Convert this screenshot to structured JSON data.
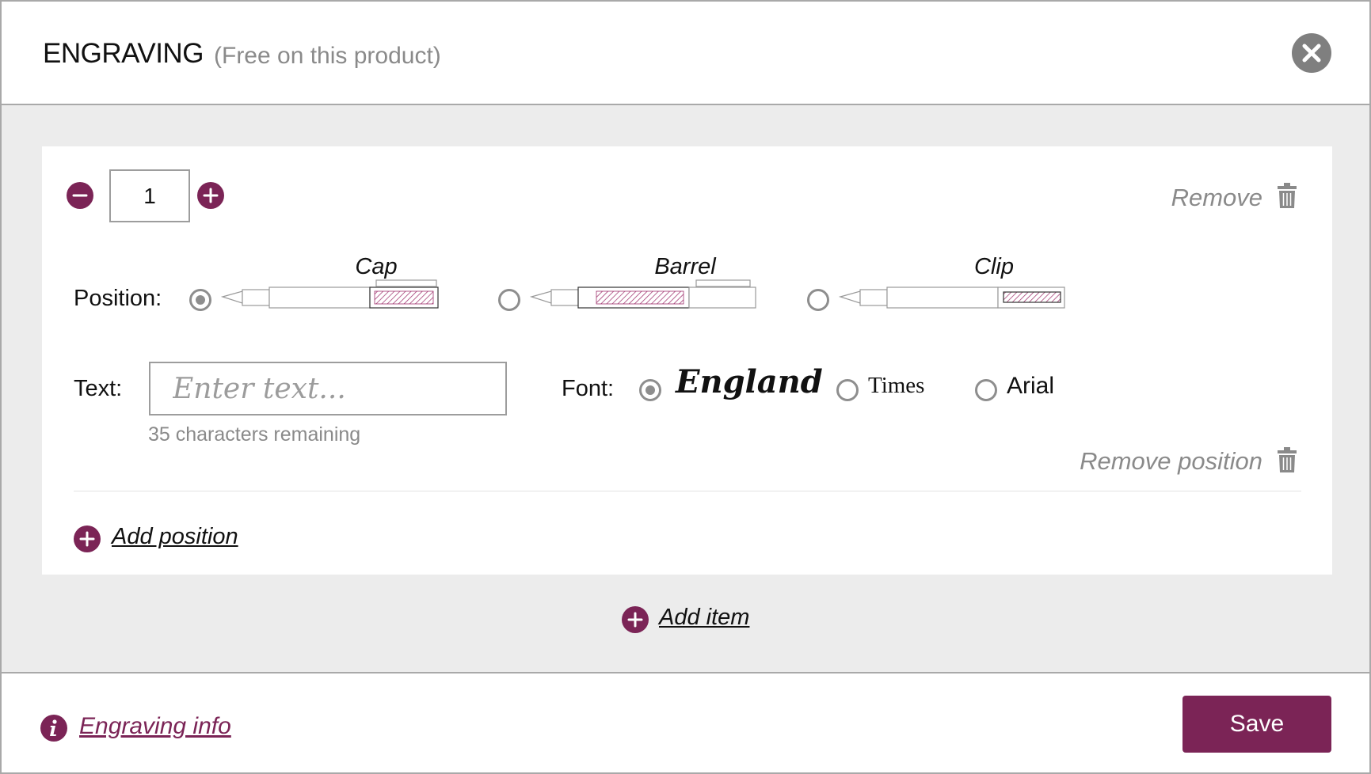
{
  "header": {
    "title": "ENGRAVING",
    "subtitle": "(Free on this product)",
    "close_icon": "close-icon"
  },
  "item": {
    "quantity": "1",
    "remove_label": "Remove",
    "position_label": "Position:",
    "positions": [
      {
        "label": "Cap",
        "selected": true
      },
      {
        "label": "Barrel",
        "selected": false
      },
      {
        "label": "Clip",
        "selected": false
      }
    ],
    "text_label": "Text:",
    "text_placeholder": "Enter text...",
    "text_value": "",
    "chars_remaining": "35 characters remaining",
    "font_label": "Font:",
    "fonts": [
      {
        "label": "England",
        "selected": true
      },
      {
        "label": "Times",
        "selected": false
      },
      {
        "label": "Arial",
        "selected": false
      }
    ],
    "remove_position_label": "Remove position",
    "add_position_label": "Add position"
  },
  "add_item_label": "Add item",
  "footer": {
    "info_label": "Engraving info",
    "save_label": "Save"
  },
  "colors": {
    "accent": "#7b2456",
    "muted_text": "#8a8a8a",
    "panel_background": "#ececec",
    "close_button": "#7f7f7f"
  }
}
